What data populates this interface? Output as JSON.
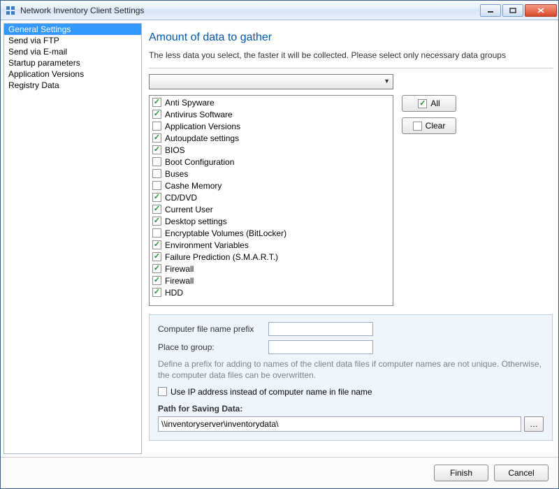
{
  "window": {
    "title": "Network Inventory Client Settings"
  },
  "sidebar": {
    "items": [
      {
        "label": "General Settings",
        "selected": true
      },
      {
        "label": "Send via FTP",
        "selected": false
      },
      {
        "label": "Send via E-mail",
        "selected": false
      },
      {
        "label": "Startup parameters",
        "selected": false
      },
      {
        "label": "Application Versions",
        "selected": false
      },
      {
        "label": "Registry Data",
        "selected": false
      }
    ]
  },
  "main": {
    "title": "Amount of data to gather",
    "description": "The less data you select, the faster it will be collected. Please select only necessary data groups",
    "combo_value": "",
    "checklist": [
      {
        "label": "Anti Spyware",
        "checked": true
      },
      {
        "label": "Antivirus Software",
        "checked": true
      },
      {
        "label": "Application Versions",
        "checked": false
      },
      {
        "label": "Autoupdate settings",
        "checked": true
      },
      {
        "label": "BIOS",
        "checked": true
      },
      {
        "label": "Boot Configuration",
        "checked": false
      },
      {
        "label": "Buses",
        "checked": false
      },
      {
        "label": "Cashe Memory",
        "checked": false
      },
      {
        "label": "CD/DVD",
        "checked": true
      },
      {
        "label": "Current User",
        "checked": true
      },
      {
        "label": "Desktop settings",
        "checked": true
      },
      {
        "label": "Encryptable Volumes (BitLocker)",
        "checked": false
      },
      {
        "label": "Environment Variables",
        "checked": true
      },
      {
        "label": "Failure Prediction (S.M.A.R.T.)",
        "checked": true
      },
      {
        "label": "Firewall",
        "checked": true
      },
      {
        "label": "Firewall",
        "checked": true
      },
      {
        "label": "HDD",
        "checked": true
      }
    ],
    "buttons": {
      "all": "All",
      "clear": "Clear"
    }
  },
  "options": {
    "prefix_label": "Computer file name prefix",
    "prefix_value": "",
    "group_label": "Place to group:",
    "group_value": "",
    "help": "Define a prefix for adding to names of the client data files if computer names are not unique. Otherwise, the computer data files can be overwritten.",
    "use_ip_label": "Use IP address instead of computer name in file name",
    "use_ip_checked": false,
    "path_label": "Path for Saving Data:",
    "path_value": "\\\\inventoryserver\\inventorydata\\"
  },
  "footer": {
    "finish": "Finish",
    "cancel": "Cancel"
  }
}
